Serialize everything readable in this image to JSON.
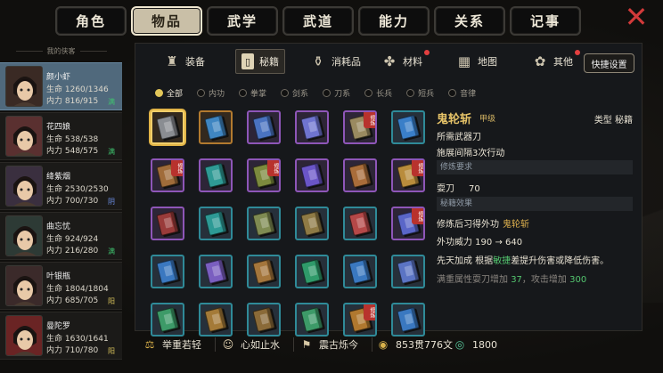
{
  "top_tabs": [
    {
      "label": "角色",
      "badge": false,
      "active": false
    },
    {
      "label": "物品",
      "badge": true,
      "active": true
    },
    {
      "label": "武学",
      "badge": true,
      "active": false
    },
    {
      "label": "武道",
      "badge": true,
      "active": false
    },
    {
      "label": "能力",
      "badge": true,
      "active": false
    },
    {
      "label": "关系",
      "badge": true,
      "active": false
    },
    {
      "label": "记事",
      "badge": false,
      "active": false
    }
  ],
  "close_icon": "close-x-icon",
  "sidebar": {
    "title": "我的侠客",
    "characters": [
      {
        "name": "颜小虾",
        "hp": "生命 1260/1346",
        "mp": "内力 816/915",
        "badge": "满",
        "active": true
      },
      {
        "name": "花四娘",
        "hp": "生命 538/538",
        "mp": "内力 548/575",
        "badge": "满",
        "active": false
      },
      {
        "name": "绛紫烟",
        "hp": "生命 2530/2530",
        "mp": "内力 700/730",
        "badge": "阴",
        "active": false
      },
      {
        "name": "曲忘忧",
        "hp": "生命 924/924",
        "mp": "内力 216/280",
        "badge": "满",
        "active": false
      },
      {
        "name": "叶银瓶",
        "hp": "生命 1804/1804",
        "mp": "内力 685/705",
        "badge": "阳",
        "active": false
      },
      {
        "name": "曼陀罗",
        "hp": "生命 1630/1641",
        "mp": "内力 710/780",
        "badge": "阳",
        "active": false
      }
    ]
  },
  "sub_tabs": [
    {
      "label": "装备",
      "icon": "armor-icon",
      "badge": false
    },
    {
      "label": "秘籍",
      "icon": "scroll-icon",
      "badge": false,
      "active": true
    },
    {
      "label": "消耗品",
      "icon": "flask-icon",
      "badge": false
    },
    {
      "label": "材料",
      "icon": "herb-icon",
      "badge": true
    },
    {
      "label": "地图",
      "icon": "map-icon",
      "badge": false
    },
    {
      "label": "其他",
      "icon": "lantern-icon",
      "badge": true
    }
  ],
  "quick_setting": "快捷设置",
  "filters": [
    "全部",
    "内功",
    "拳掌",
    "剑系",
    "刀系",
    "长兵",
    "短兵",
    "音律"
  ],
  "selected_filter": "全部",
  "tag_label": "修炼",
  "grid": [
    [
      {
        "frame": "orange",
        "book": "#8a8d92",
        "sel": true
      },
      {
        "frame": "orange",
        "book": "#3f86c2"
      },
      {
        "frame": "purple",
        "book": "#4a73c0"
      },
      {
        "frame": "purple",
        "book": "#6f74d0"
      },
      {
        "frame": "purple",
        "book": "#9a8a60",
        "tag": true
      },
      {
        "frame": "teal",
        "book": "#3a7fc8"
      }
    ],
    [
      {
        "frame": "purple",
        "book": "#a06c3a",
        "tag": true
      },
      {
        "frame": "purple",
        "book": "#2f9a95"
      },
      {
        "frame": "purple",
        "book": "#7c8a3e",
        "tag": true
      },
      {
        "frame": "purple",
        "book": "#6a55c8"
      },
      {
        "frame": "purple",
        "book": "#a96d3a"
      },
      {
        "frame": "purple",
        "book": "#b98c3c",
        "tag": true
      }
    ],
    [
      {
        "frame": "purple",
        "book": "#9a3b3a"
      },
      {
        "frame": "teal",
        "book": "#2d9a95"
      },
      {
        "frame": "teal",
        "book": "#7f8b52"
      },
      {
        "frame": "teal",
        "book": "#8e7a45"
      },
      {
        "frame": "teal",
        "book": "#b54848"
      },
      {
        "frame": "purple",
        "book": "#5a66c8",
        "tag": true
      }
    ],
    [
      {
        "frame": "teal",
        "book": "#3a78c0"
      },
      {
        "frame": "teal",
        "book": "#7a5ec0"
      },
      {
        "frame": "teal",
        "book": "#a4763c"
      },
      {
        "frame": "teal",
        "book": "#2f9a6a"
      },
      {
        "frame": "teal",
        "book": "#3a78c0"
      },
      {
        "frame": "teal",
        "book": "#5b74c4"
      }
    ],
    [
      {
        "frame": "teal",
        "book": "#3d9a68"
      },
      {
        "frame": "teal",
        "book": "#a47a38"
      },
      {
        "frame": "teal",
        "book": "#8a6a38"
      },
      {
        "frame": "teal",
        "book": "#3d9a68"
      },
      {
        "frame": "teal",
        "book": "#b0782f",
        "tag": true
      },
      {
        "frame": "teal",
        "book": "#3a78c0"
      }
    ]
  ],
  "detail": {
    "name": "鬼轮斩",
    "grade": "甲级",
    "type": "类型  秘籍",
    "weapon": "所需武器刀",
    "interval": "施展间隔3次行动",
    "req_header": "修炼要求",
    "req_label": "耍刀",
    "req_value": "70",
    "effect_header": "秘籍效果",
    "learn_prefix": "修炼后习得外功",
    "learn_skill": "鬼轮斩",
    "power": "外功威力   190 → 640",
    "desc_a": "先天加成 根据",
    "desc_hl": "敏捷",
    "desc_b": "差提升伤害或降低伤害。",
    "full_a": "满重属性耍刀增加 ",
    "full_n1": "37",
    "full_b": "，攻击增加 ",
    "full_n2": "300"
  },
  "bottom": [
    {
      "label": "举重若轻",
      "icon": "weight-icon"
    },
    {
      "label": "心如止水",
      "icon": "calm-face-icon"
    },
    {
      "label": "震古烁今",
      "icon": "flag-icon"
    },
    {
      "label": "853贯776文",
      "icon": "coin-icon"
    },
    {
      "label": "1800",
      "icon": "jade-icon"
    }
  ]
}
